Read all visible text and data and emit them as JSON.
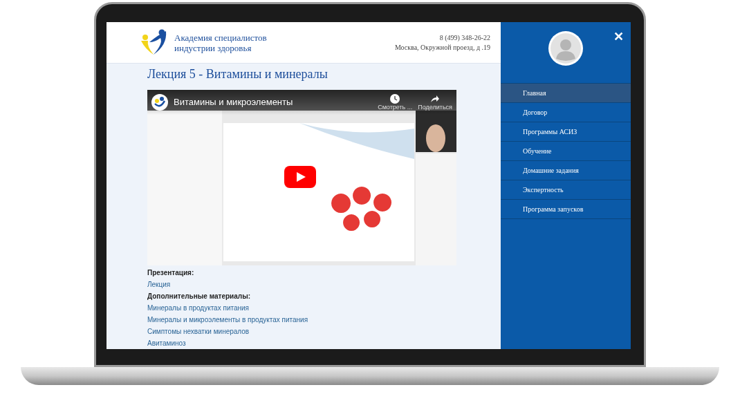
{
  "header": {
    "logo_text": [
      "Академия специалистов",
      "индустрии здоровья"
    ],
    "phone": "8 (499) 348-26-22",
    "address": "Москва, Окружной проезд, д .19"
  },
  "page_title": "Лекция 5 - Витамины и минералы",
  "video": {
    "title": "Витамины и микроэлементы",
    "watch_later": "Смотреть ...",
    "share": "Поделиться"
  },
  "materials": [
    {
      "kind": "heading",
      "text": "Презентация:"
    },
    {
      "kind": "link",
      "text": "Лекция"
    },
    {
      "kind": "heading",
      "text": "Дополнительные материалы:"
    },
    {
      "kind": "link",
      "text": "Минералы в продуктах питания"
    },
    {
      "kind": "link",
      "text": "Минералы и микроэлементы в продуктах питания"
    },
    {
      "kind": "link",
      "text": "Симптомы нехватки минералов"
    },
    {
      "kind": "link",
      "text": "Авитаминоз"
    }
  ],
  "sidebar": {
    "close": "✕",
    "items": [
      {
        "label": "Главная",
        "selected": true
      },
      {
        "label": "Договор",
        "selected": false
      },
      {
        "label": "Программы АСИЗ",
        "selected": false
      },
      {
        "label": "Обучение",
        "selected": false
      },
      {
        "label": "Домашние задания",
        "selected": false
      },
      {
        "label": "Экспертность",
        "selected": false
      },
      {
        "label": "Программа запусков",
        "selected": false
      }
    ]
  }
}
